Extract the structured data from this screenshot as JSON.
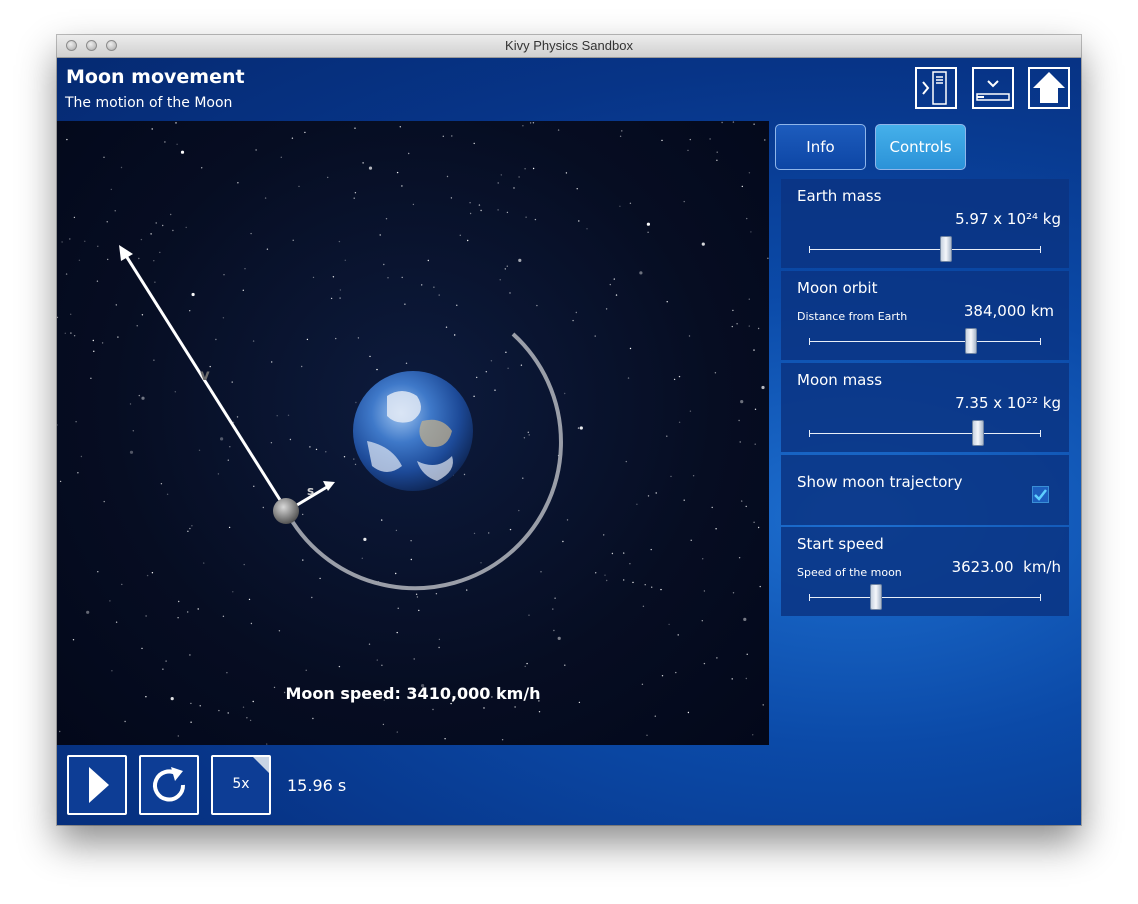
{
  "window": {
    "title": "Kivy Physics Sandbox"
  },
  "header": {
    "title": "Moon movement",
    "subtitle": "The motion of the Moon"
  },
  "top_buttons": [
    {
      "icon": "sidebar-toggle-icon"
    },
    {
      "icon": "collapse-panel-icon"
    },
    {
      "icon": "home-icon"
    }
  ],
  "tabs": [
    {
      "label": "Info",
      "active": false
    },
    {
      "label": "Controls",
      "active": true
    }
  ],
  "controls": {
    "earth_mass": {
      "label": "Earth mass",
      "value": "5.97 x 10²⁴ kg",
      "position": 0.59
    },
    "moon_orbit": {
      "label": "Moon orbit",
      "sublabel": "Distance from Earth",
      "value": "384,000 km",
      "position": 0.7
    },
    "moon_mass": {
      "label": "Moon mass",
      "value": "7.35 x 10²² kg",
      "position": 0.73
    },
    "show_trajectory": {
      "label": "Show moon trajectory",
      "checked": true
    },
    "start_speed": {
      "label": "Start speed",
      "sublabel": "Speed of the moon",
      "value": "3623.00  km/h",
      "position": 0.29
    }
  },
  "simulation": {
    "speed_text": "Moon speed: 3410,000 km/h",
    "velocity_label": "v",
    "force_label": "s"
  },
  "playback": {
    "speed_multiplier": "5x",
    "time": "15.96 s"
  },
  "colors": {
    "accent": "#2b92d8",
    "background": "#0a3a8e"
  }
}
